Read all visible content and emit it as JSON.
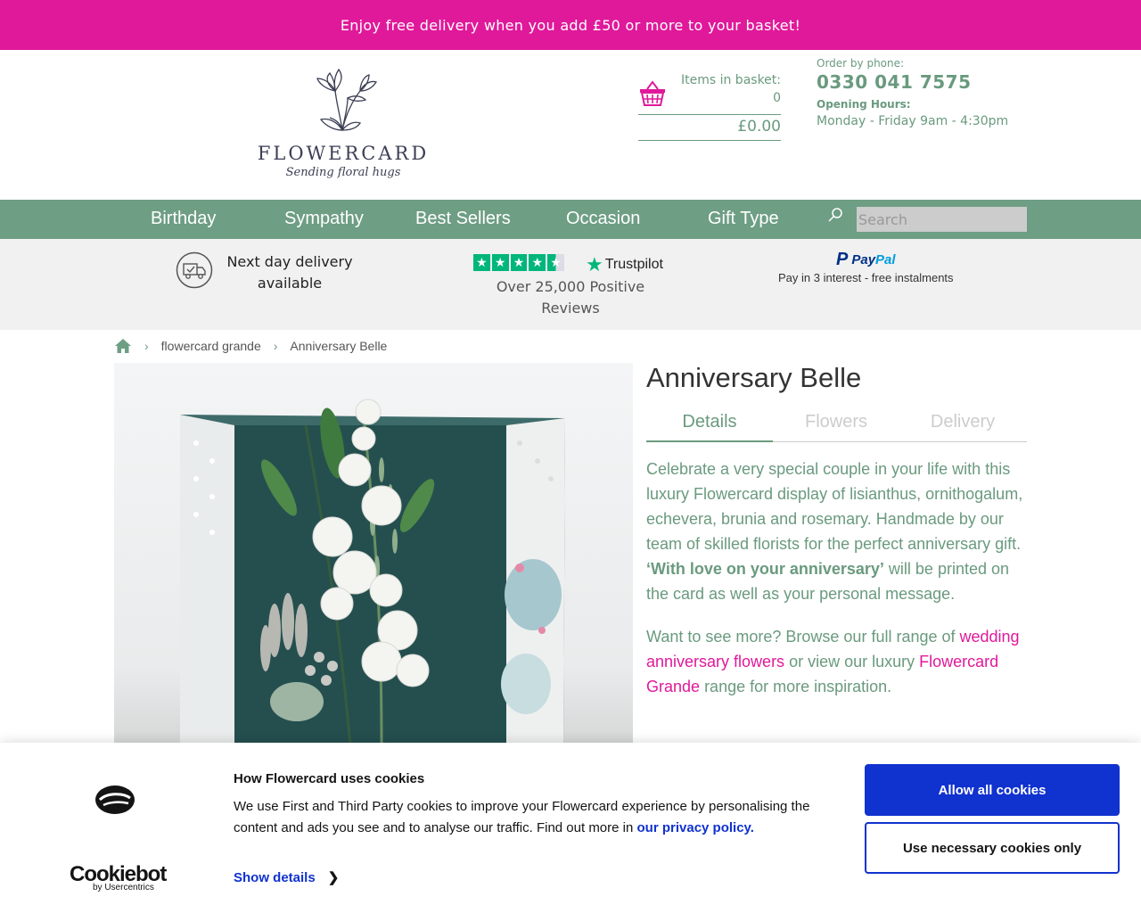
{
  "promo": {
    "text": "Enjoy free delivery when you add £50 or more to your basket!"
  },
  "header": {
    "logo": {
      "word": "FLOWERCARD",
      "tagline": "Sending floral hugs",
      "icon": "flower-logo-icon"
    },
    "basket": {
      "label": "Items in basket:",
      "count": "0",
      "total": "£0.00",
      "icon": "basket-icon"
    },
    "phone": {
      "label": "Order by phone:",
      "number": "0330 041 7575",
      "hours_label": "Opening Hours:",
      "hours": "Monday - Friday 9am - 4:30pm"
    }
  },
  "nav": {
    "items": [
      "Birthday",
      "Sympathy",
      "Best Sellers",
      "Occasion",
      "Gift Type"
    ],
    "search_placeholder": "Search",
    "search_icon": "search-icon"
  },
  "trust": {
    "delivery": {
      "line1": "Next day delivery",
      "line2": "available",
      "icon": "delivery-van-icon"
    },
    "trustpilot": {
      "brand": "Trustpilot",
      "line1": "Over 25,000 Positive",
      "line2": "Reviews",
      "stars": 4.5
    },
    "paypal": {
      "brand_a": "Pay",
      "brand_b": "Pal",
      "sub": "Pay in 3 interest - free instalments"
    }
  },
  "breadcrumb": {
    "items": [
      "flowercard grande",
      "Anniversary Belle"
    ],
    "home_icon": "home-icon"
  },
  "product": {
    "title": "Anniversary Belle",
    "tabs": [
      "Details",
      "Flowers",
      "Delivery"
    ],
    "active_tab": "Details",
    "desc1": "Celebrate a very special couple in your life with this luxury Flowercard display of lisianthus, ornithogalum, echevera, brunia and rosemary. Handmade by our team of skilled florists for the perfect anniversary gift.",
    "desc1_bold": "‘With love on your anniversary’",
    "desc1_end": "will be printed on the card as well as your personal message.",
    "desc2_a": "Want to see more? Browse our full range of",
    "desc2_link1": "wedding anniversary flowers",
    "desc2_b": "or view our luxury",
    "desc2_link2": "Flowercard Grande",
    "desc2_c": "range for more inspiration."
  },
  "cookie": {
    "title": "How Flowercard uses cookies",
    "body": "We use First and Third Party cookies to improve your Flowercard experience by personalising the content and ads you see and to analyse our traffic. Find out more in",
    "link": "our privacy policy.",
    "show_details": "Show details",
    "allow_all": "Allow all cookies",
    "necessary_only": "Use necessary cookies only",
    "brand": "Cookiebot",
    "brand_by": "by Usercentrics"
  },
  "colors": {
    "promo": "#e0199a",
    "accent_green": "#6e9e84",
    "cookie_blue": "#1032cf"
  }
}
